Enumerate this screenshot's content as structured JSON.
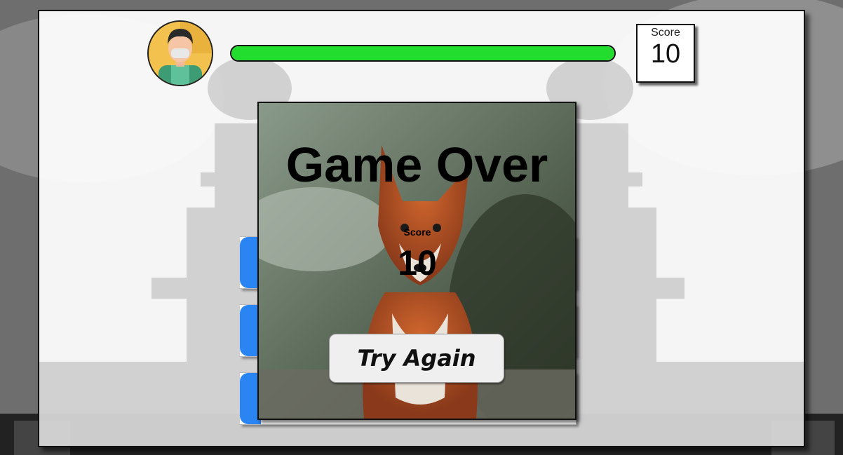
{
  "hud": {
    "avatar_icon": "player-avatar-icon",
    "progress_fraction": 1.0,
    "progress_color": "#22dd2e",
    "score_label": "Score",
    "score_value": "10"
  },
  "options": {
    "accent_color": "#2a85f2",
    "count": 3
  },
  "game_over": {
    "title": "Game Over",
    "score_label": "Score",
    "score_value": "10",
    "try_again_label": "Try Again",
    "background_image": "fox-photo"
  }
}
